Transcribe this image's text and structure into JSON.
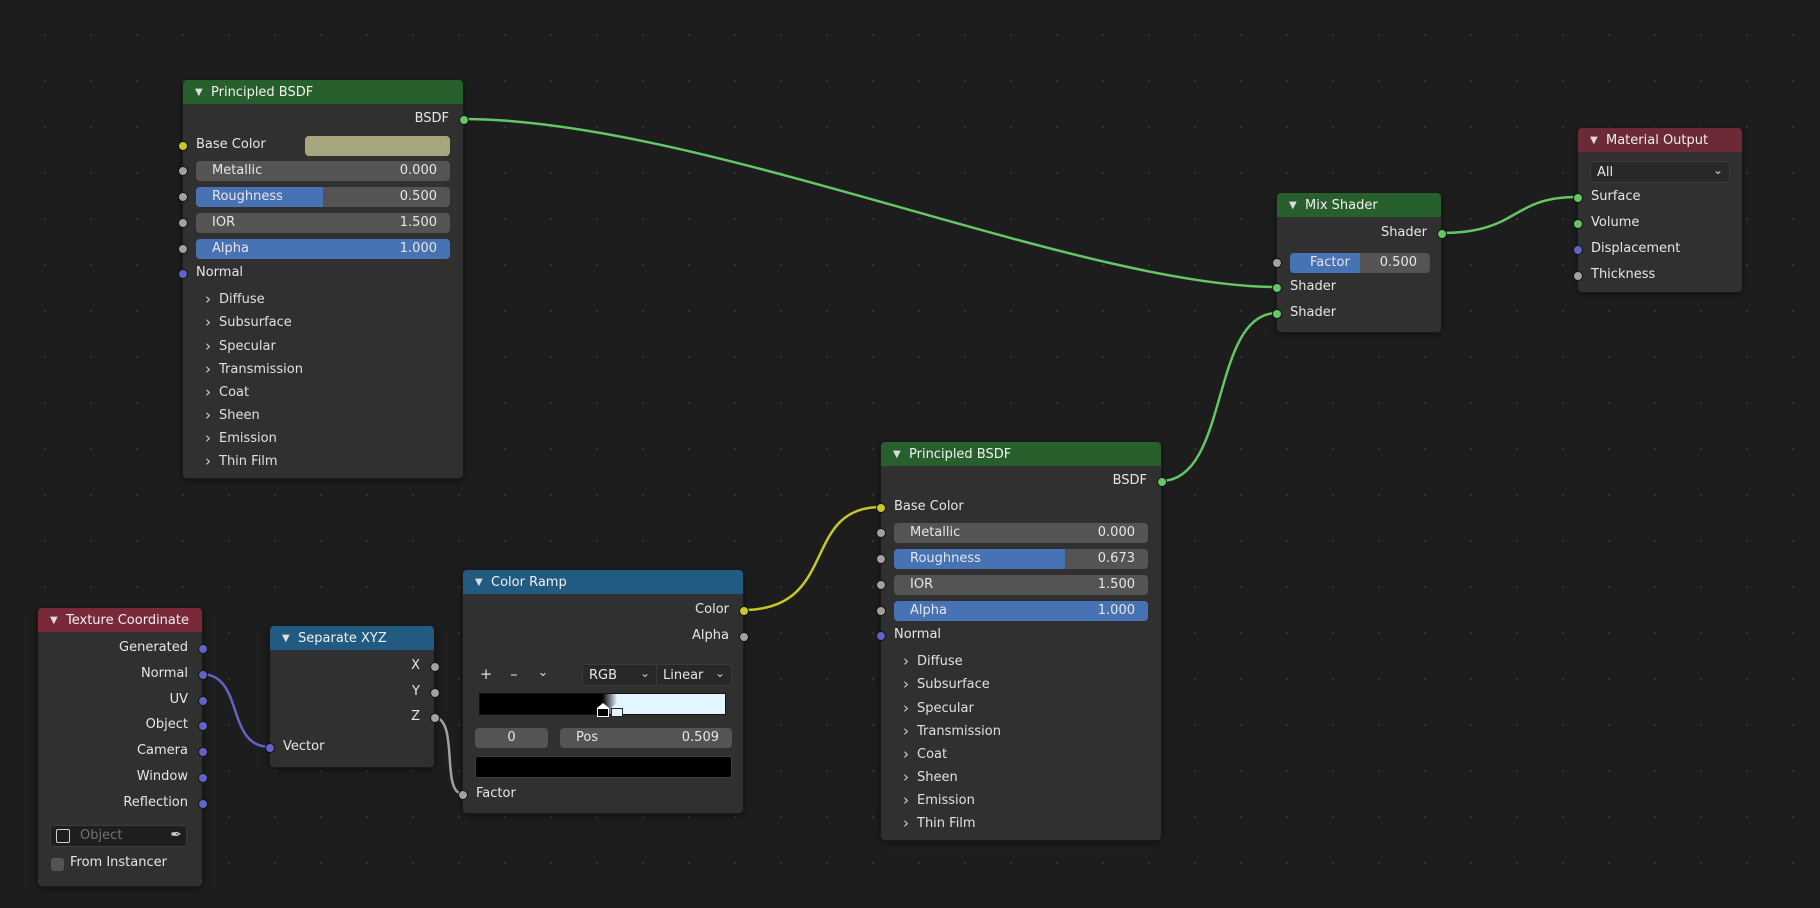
{
  "colors": {
    "shader_header": "#27602c",
    "input_header": "#7a2939",
    "converter_header": "#225b82",
    "output_header": "#6b2a36",
    "socket_shader": "#63c763",
    "socket_color": "#c7c729",
    "socket_float": "#a1a1a1",
    "socket_vector": "#6363c7",
    "slider_fill": "#4772b3"
  },
  "bsdf1": {
    "title": "Principled BSDF",
    "output": "BSDF",
    "base_color_label": "Base Color",
    "base_color_value": "#a6a67e",
    "metallic_label": "Metallic",
    "metallic_value": "0.000",
    "metallic_fraction": 0.0,
    "roughness_label": "Roughness",
    "roughness_value": "0.500",
    "roughness_fraction": 0.5,
    "ior_label": "IOR",
    "ior_value": "1.500",
    "alpha_label": "Alpha",
    "alpha_value": "1.000",
    "alpha_fraction": 1.0,
    "normal_label": "Normal",
    "panels": [
      "Diffuse",
      "Subsurface",
      "Specular",
      "Transmission",
      "Coat",
      "Sheen",
      "Emission",
      "Thin Film"
    ]
  },
  "bsdf2": {
    "title": "Principled BSDF",
    "output": "BSDF",
    "base_color_label": "Base Color",
    "metallic_label": "Metallic",
    "metallic_value": "0.000",
    "metallic_fraction": 0.0,
    "roughness_label": "Roughness",
    "roughness_value": "0.673",
    "roughness_fraction": 0.673,
    "ior_label": "IOR",
    "ior_value": "1.500",
    "alpha_label": "Alpha",
    "alpha_value": "1.000",
    "alpha_fraction": 1.0,
    "normal_label": "Normal",
    "panels": [
      "Diffuse",
      "Subsurface",
      "Specular",
      "Transmission",
      "Coat",
      "Sheen",
      "Emission",
      "Thin Film"
    ]
  },
  "mix": {
    "title": "Mix Shader",
    "output": "Shader",
    "factor_label": "Factor",
    "factor_value": "0.500",
    "factor_fraction": 0.5,
    "shader1_label": "Shader",
    "shader2_label": "Shader"
  },
  "material_output": {
    "title": "Material Output",
    "target": "All",
    "surface": "Surface",
    "volume": "Volume",
    "displacement": "Displacement",
    "thickness": "Thickness"
  },
  "texcoord": {
    "title": "Texture Coordinate",
    "outputs": [
      "Generated",
      "Normal",
      "UV",
      "Object",
      "Camera",
      "Window",
      "Reflection"
    ],
    "object_placeholder": "Object",
    "from_instancer": "From Instancer",
    "from_instancer_checked": false
  },
  "sepxyz": {
    "title": "Separate XYZ",
    "x": "X",
    "y": "Y",
    "z": "Z",
    "vector": "Vector"
  },
  "colorramp": {
    "title": "Color Ramp",
    "color_out": "Color",
    "alpha_out": "Alpha",
    "add": "+",
    "remove": "–",
    "color_mode": "RGB",
    "interpolation": "Linear",
    "active_stop": "0",
    "pos_label": "Pos",
    "pos_value": "0.509",
    "stops": [
      {
        "position": 0.5,
        "color": "#000000"
      },
      {
        "position": 0.56,
        "color": "#e3f6ff"
      }
    ],
    "factor": "Factor",
    "active_color": "#000000"
  },
  "icons": {
    "collapse": "chevron-down-icon",
    "panel": "chevron-right-icon",
    "object": "object-cube-icon",
    "eyedropper": "eyedropper-icon"
  }
}
